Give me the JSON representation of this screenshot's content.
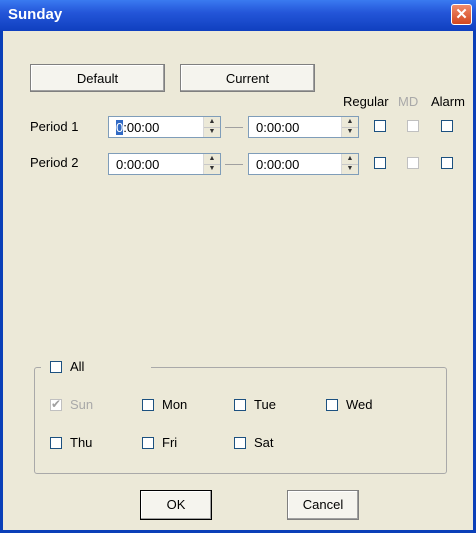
{
  "window": {
    "title": "Sunday",
    "close_symbol": "✕"
  },
  "buttons": {
    "default": "Default",
    "current": "Current",
    "ok": "OK",
    "cancel": "Cancel"
  },
  "headers": {
    "regular": "Regular",
    "md": "MD",
    "alarm": "Alarm"
  },
  "periods": [
    {
      "label": "Period 1",
      "start": "0:00:00",
      "end": "0:00:00"
    },
    {
      "label": "Period 2",
      "start": "0:00:00",
      "end": "0:00:00"
    }
  ],
  "days": {
    "all": "All",
    "sun": "Sun",
    "mon": "Mon",
    "tue": "Tue",
    "wed": "Wed",
    "thu": "Thu",
    "fri": "Fri",
    "sat": "Sat"
  },
  "colors": {
    "titlebar": "#2456d9",
    "face": "#ece9d8",
    "selection": "#316ac5"
  }
}
